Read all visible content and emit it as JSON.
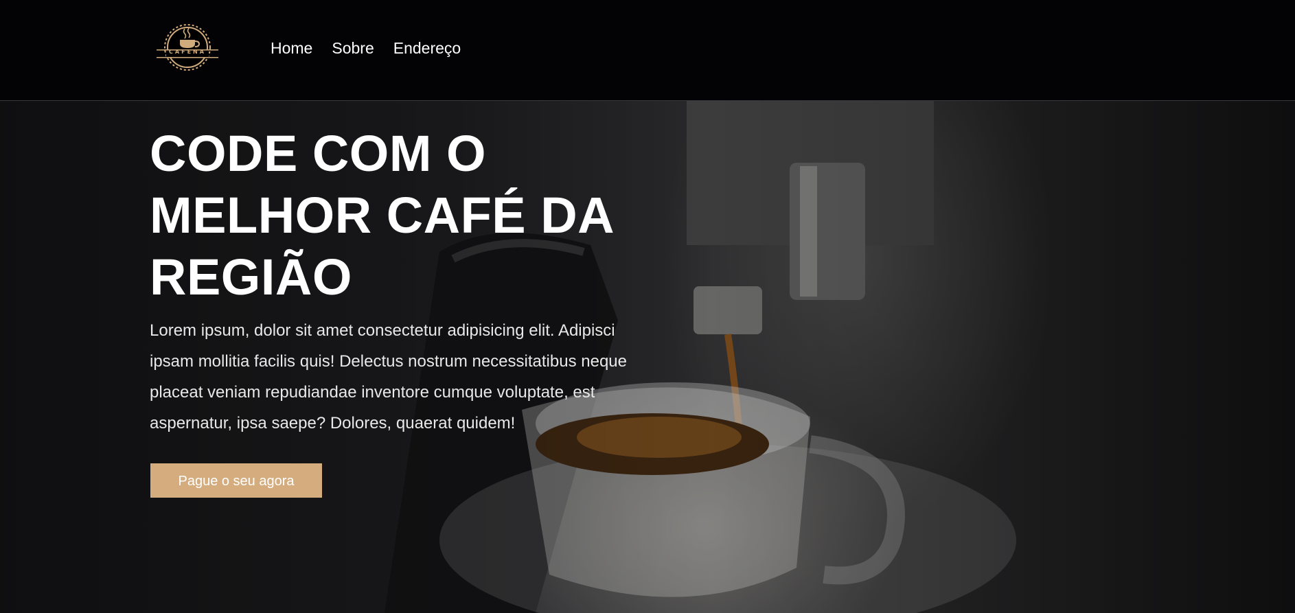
{
  "header": {
    "logo_text": "CAFENA",
    "nav": [
      "Home",
      "Sobre",
      "Endereço"
    ]
  },
  "hero": {
    "title": "CODE COM O MELHOR CAFÉ DA REGIÃO",
    "text": "Lorem ipsum, dolor sit amet consectetur adipisicing elit. Adipisci ipsam mollitia facilis quis! Delectus nostrum necessitatibus neque placeat veniam repudiandae inventore cumque voluptate, est aspernatur, ipsa saepe? Dolores, quaerat quidem!",
    "button_label": "Pague o seu agora"
  },
  "colors": {
    "accent": "#d4ac7d",
    "header_bg": "#030305",
    "text": "#ffffff"
  },
  "icons": {
    "logo": "coffee-cup-gear-logo"
  }
}
